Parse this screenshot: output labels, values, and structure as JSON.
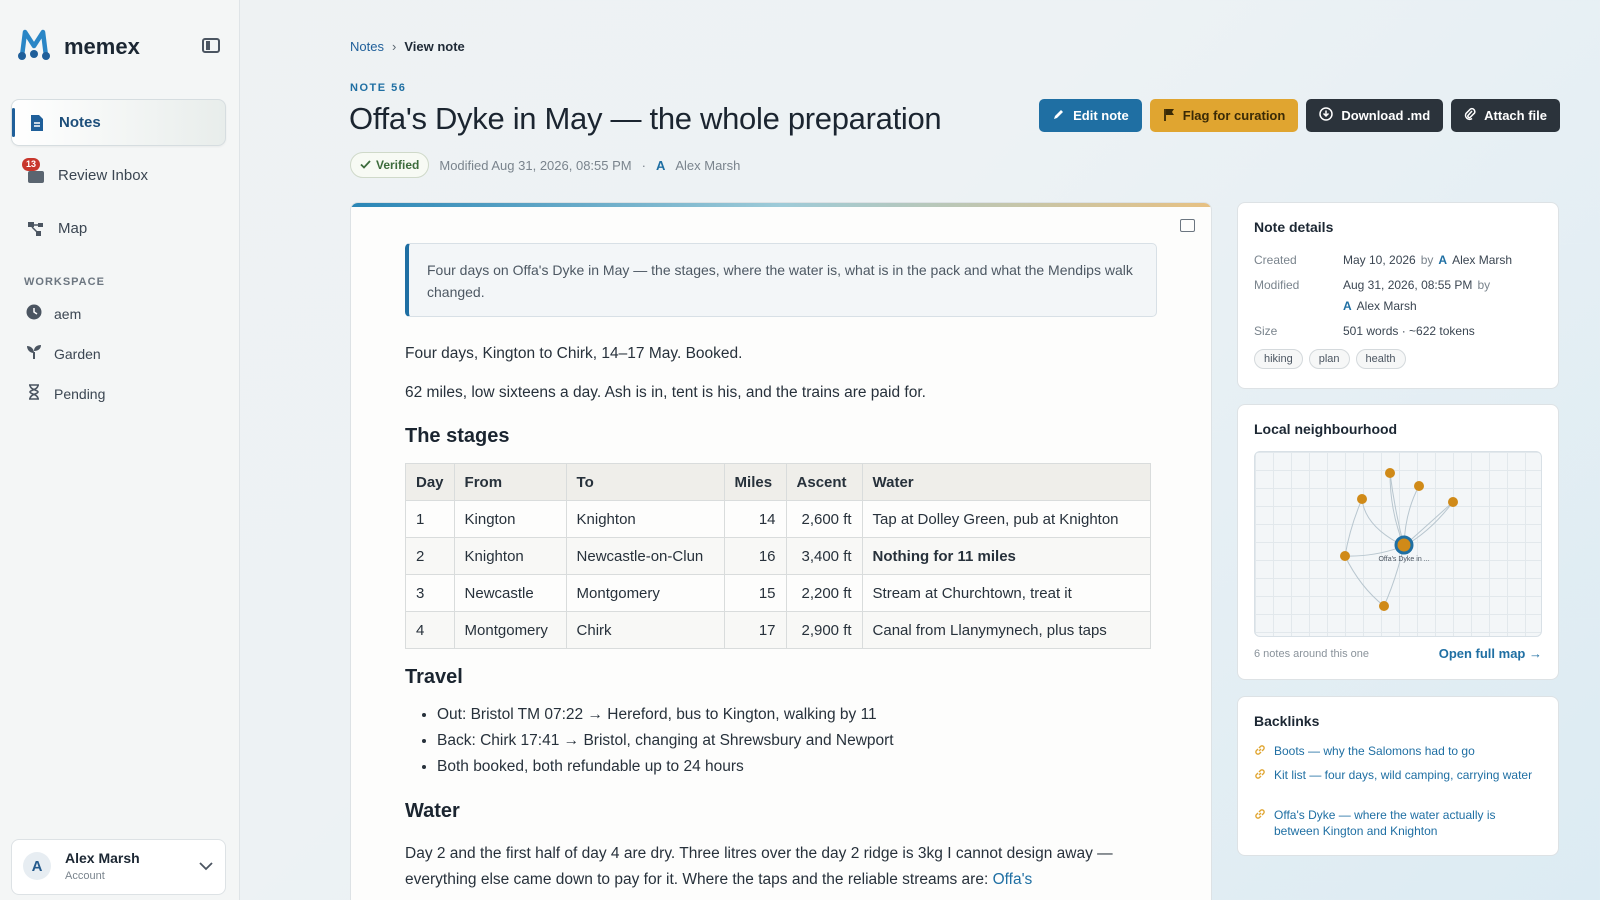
{
  "app": {
    "name": "memex"
  },
  "sidebar": {
    "items": [
      {
        "label": "Notes",
        "active": true
      },
      {
        "label": "Review Inbox",
        "badge": "13"
      },
      {
        "label": "Map"
      }
    ],
    "workspace_label": "WORKSPACE",
    "workspace_items": [
      {
        "label": "aem"
      },
      {
        "label": "Garden"
      },
      {
        "label": "Pending"
      }
    ],
    "account": {
      "initial": "A",
      "name": "Alex Marsh",
      "sub": "Account"
    }
  },
  "breadcrumb": {
    "parent": "Notes",
    "separator": "›",
    "current": "View note"
  },
  "note": {
    "number": "NOTE 56",
    "title": "Offa's Dyke in May — the whole preparation",
    "status": "Verified",
    "modified": "Modified Aug 31, 2026, 08:55 PM",
    "dot": "·",
    "author_initial": "A",
    "author": "Alex Marsh"
  },
  "actions": {
    "edit": "Edit note",
    "flag": "Flag for curation",
    "download": "Download .md",
    "attach": "Attach file"
  },
  "body": {
    "summary": "Four days on Offa's Dyke in May — the stages, where the water is, what is in the pack and what the Mendips walk changed.",
    "p1": "Four days, Kington to Chirk, 14–17 May. Booked.",
    "p2": "62 miles, low sixteens a day. Ash is in, tent is his, and the trains are paid for.",
    "h_stages": "The stages",
    "table": {
      "headers": [
        "Day",
        "From",
        "To",
        "Miles",
        "Ascent",
        "Water"
      ],
      "rows": [
        [
          "1",
          "Kington",
          "Knighton",
          "14",
          "2,600 ft",
          "Tap at Dolley Green, pub at Knighton"
        ],
        [
          "2",
          "Knighton",
          "Newcastle-on-Clun",
          "16",
          "3,400 ft",
          "Nothing for 11 miles"
        ],
        [
          "3",
          "Newcastle",
          "Montgomery",
          "15",
          "2,200 ft",
          "Stream at Churchtown, treat it"
        ],
        [
          "4",
          "Montgomery",
          "Chirk",
          "17",
          "2,900 ft",
          "Canal from Llanymynech, plus taps"
        ]
      ]
    },
    "h_travel": "Travel",
    "travel": [
      "Out: Bristol TM 07:22 → Hereford, bus to Kington, walking by 11",
      "Back: Chirk 17:41 → Bristol, changing at Shrewsbury and Newport",
      "Both booked, both refundable up to 24 hours"
    ],
    "h_water": "Water",
    "water_text": "Day 2 and the first half of day 4 are dry. Three litres over the day 2 ridge is 3kg I cannot design away — everything else came down to pay for it. Where the taps and the reliable streams are: ",
    "water_link": "Offa's"
  },
  "details": {
    "title": "Note details",
    "created_label": "Created",
    "created": "May 10, 2026",
    "by": "by",
    "modified_label": "Modified",
    "modified": "Aug 31, 2026, 08:55 PM",
    "author_initial": "A",
    "author": "Alex Marsh",
    "size_label": "Size",
    "size": "501 words · ~622 tokens",
    "tags": [
      "hiking",
      "plan",
      "health"
    ]
  },
  "neighbourhood": {
    "title": "Local neighbourhood",
    "center_label": "Offa's Dyke in ...",
    "caption": "6 notes around this one",
    "open_map": "Open full map →"
  },
  "backlinks": {
    "title": "Backlinks",
    "items": [
      "Boots — why the Salomons had to go",
      "Kit list — four days, wild camping, carrying water",
      "Offa's Dyke — where the water actually is between Kington and Knighton"
    ]
  },
  "colors": {
    "accent": "#1f6fa3",
    "flag": "#e0a530",
    "dark": "#2b333b",
    "node": "#d08a18"
  }
}
